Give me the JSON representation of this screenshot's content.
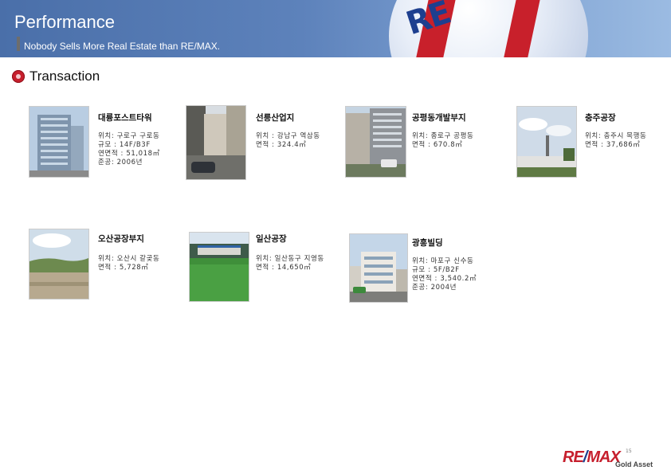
{
  "header": {
    "title": "Performance",
    "subtitle": "Nobody Sells More Real Estate than RE/MAX.",
    "balloon_text": "RE"
  },
  "section": {
    "title": "Transaction",
    "icon": "target-bullet-icon"
  },
  "properties": [
    {
      "name": "대륭포스트타워",
      "details": [
        "위치: 구로구 구로동",
        "규모 : 14F/B3F",
        "연면적 : 51,018㎡",
        "준공: 2006년"
      ]
    },
    {
      "name": "선릉산업지",
      "details": [
        "위치 : 강남구 역삼동",
        "면적 : 324.4㎡"
      ]
    },
    {
      "name": "공평동개발부지",
      "details": [
        "위치: 종로구 공평동",
        "면적 : 670.8㎡"
      ]
    },
    {
      "name": "충주공장",
      "details": [
        "위치: 충주시 목행동",
        "면적 : 37,686㎡"
      ]
    },
    {
      "name": "오산공장부지",
      "details": [
        "위치: 오산시 갈곶동",
        "면적 : 5,728㎡"
      ]
    },
    {
      "name": "일산공장",
      "details": [
        "위치: 일산동구 지영동",
        "면적 : 14,650㎡"
      ]
    },
    {
      "name": "광흥빌딩",
      "details": [
        "위치: 마포구 신수동",
        "규모 : 5F/B2F",
        "연면적 : 3,540.2㎡",
        "준공: 2004년"
      ]
    }
  ],
  "footer": {
    "page_number": "15",
    "logo_main_a": "RE",
    "logo_slash": "/",
    "logo_main_b": "MAX",
    "logo_sub": "Gold Asset"
  },
  "colors": {
    "brand_red": "#c61f2d",
    "brand_blue": "#1d3f8f",
    "banner_blue": "#5d82bb"
  }
}
